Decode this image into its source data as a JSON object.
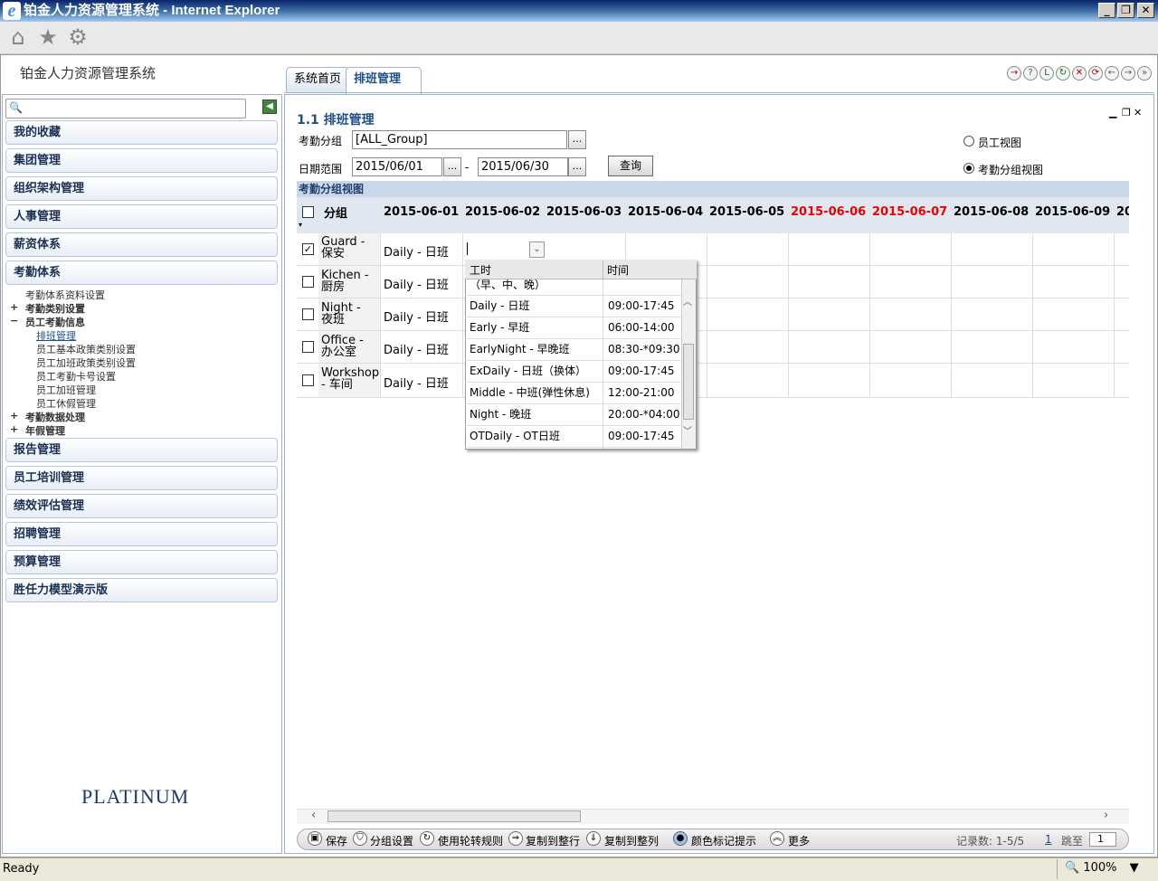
{
  "window": {
    "title": "铂金人力资源管理系统 - Internet Explorer",
    "minimize": "_",
    "restore": "❐",
    "close": "✕"
  },
  "browser_toolbar": {
    "icons": [
      "home-icon",
      "favorites-star-icon",
      "settings-gear-icon"
    ]
  },
  "app": {
    "title": "铂金人力资源管理系统",
    "tabs": [
      {
        "label": "系统首页",
        "active": false
      },
      {
        "label": "排班管理",
        "active": true
      }
    ],
    "brand": "PLATINUM"
  },
  "sidebar": {
    "search_placeholder": "",
    "menus": [
      {
        "label": "我的收藏"
      },
      {
        "label": "集团管理"
      },
      {
        "label": "组织架构管理"
      },
      {
        "label": "人事管理"
      },
      {
        "label": "薪资体系"
      },
      {
        "label": "考勤体系"
      }
    ],
    "attendance_sub": [
      {
        "label": "考勤体系资料设置",
        "prefix": ""
      },
      {
        "label": "考勤类别设置",
        "prefix": "+"
      },
      {
        "label": "员工考勤信息",
        "prefix": "−"
      },
      {
        "label": "排班管理",
        "prefix": ""
      },
      {
        "label": "员工基本政策类别设置",
        "prefix": ""
      },
      {
        "label": "员工加班政策类别设置",
        "prefix": ""
      },
      {
        "label": "员工考勤卡号设置",
        "prefix": ""
      },
      {
        "label": "员工加班管理",
        "prefix": ""
      },
      {
        "label": "员工休假管理",
        "prefix": ""
      },
      {
        "label": "考勤数据处理",
        "prefix": "+"
      },
      {
        "label": "年假管理",
        "prefix": "+"
      }
    ],
    "menus_after": [
      {
        "label": "报告管理"
      },
      {
        "label": "员工培训管理"
      },
      {
        "label": "绩效评估管理"
      },
      {
        "label": "招聘管理"
      },
      {
        "label": "预算管理"
      },
      {
        "label": "胜任力模型演示版"
      }
    ]
  },
  "main": {
    "page_title": "1.1 排班管理",
    "group_label": "考勤分组",
    "group_value": "[ALL_Group]",
    "date_label": "日期范围",
    "date_from": "2015/06/01",
    "date_to": "2015/06/30",
    "date_sep": "-",
    "dots": "...",
    "query_button": "查询",
    "view_options": [
      {
        "label": "员工视图",
        "selected": false
      },
      {
        "label": "考勤分组视图",
        "selected": true
      }
    ],
    "grid_title": "考勤分组视图",
    "group_col": "分组",
    "dates": [
      {
        "d": "2015-06-01",
        "weekend": false
      },
      {
        "d": "2015-06-02",
        "weekend": false
      },
      {
        "d": "2015-06-03",
        "weekend": false
      },
      {
        "d": "2015-06-04",
        "weekend": false
      },
      {
        "d": "2015-06-05",
        "weekend": false
      },
      {
        "d": "2015-06-06",
        "weekend": true
      },
      {
        "d": "2015-06-07",
        "weekend": true
      },
      {
        "d": "2015-06-08",
        "weekend": false
      },
      {
        "d": "2015-06-09",
        "weekend": false
      },
      {
        "d": "20",
        "weekend": false
      }
    ],
    "rows": [
      {
        "name1": "Guard -",
        "name2": "保安",
        "shift": "Daily - 日班",
        "checked": true
      },
      {
        "name1": "Kichen -",
        "name2": "厨房",
        "shift": "Daily - 日班",
        "checked": false
      },
      {
        "name1": "Night -",
        "name2": "夜班",
        "shift": "Daily - 日班",
        "checked": false
      },
      {
        "name1": "Office -",
        "name2": "办公室",
        "shift": "Daily - 日班",
        "checked": false
      },
      {
        "name1": "Workshop",
        "name2": "- 车间",
        "shift": "Daily - 日班",
        "checked": false
      }
    ],
    "dropdown": {
      "col1": "工时",
      "col2": "时间",
      "partial_row": "（早、中、晚）",
      "items": [
        {
          "name": "Daily - 日班",
          "time": "09:00-17:45"
        },
        {
          "name": "Early - 早班",
          "time": "06:00-14:00"
        },
        {
          "name": "EarlyNight - 早晚班",
          "time": "08:30-*09:30"
        },
        {
          "name": "ExDaily - 日班（换体）",
          "time": "09:00-17:45"
        },
        {
          "name": "Middle - 中班(弹性休息)",
          "time": "12:00-21:00"
        },
        {
          "name": "Night - 晚班",
          "time": "20:00-*04:00"
        },
        {
          "name": "OTDaily - OT日班",
          "time": "09:00-17:45"
        }
      ]
    },
    "bottom_bar": {
      "save": "保存",
      "group_settings": "分组设置",
      "rotation": "使用轮转规则",
      "copy_row": "复制到整行",
      "copy_col": "复制到整列",
      "color_hint": "颜色标记提示",
      "more": "更多",
      "records": "记录数: 1-5/5",
      "page": "1",
      "jump_label": "跳至",
      "jump_value": "1"
    }
  },
  "status": {
    "text": "Ready",
    "zoom": "100%"
  },
  "colors": {
    "accent": "#1e4f86",
    "weekend": "#e00000"
  }
}
